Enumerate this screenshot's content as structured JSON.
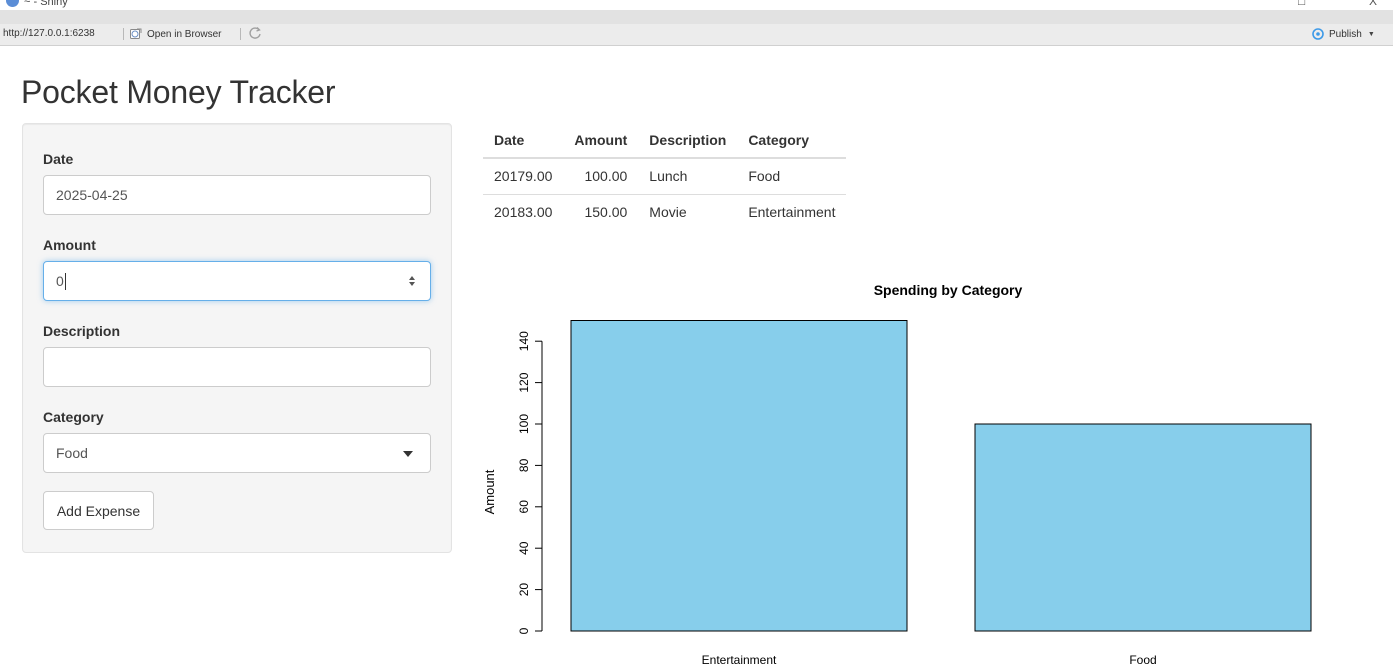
{
  "window": {
    "title": "~ - Shiny",
    "url": "http://127.0.0.1:6238",
    "open_in_browser": "Open in Browser",
    "publish": "Publish",
    "minimize_glyph": "□",
    "close_glyph": "X"
  },
  "page": {
    "title": "Pocket Money Tracker"
  },
  "form": {
    "date_label": "Date",
    "date_value": "2025-04-25",
    "amount_label": "Amount",
    "amount_value": "0",
    "description_label": "Description",
    "description_value": "",
    "category_label": "Category",
    "category_value": "Food",
    "add_button": "Add Expense"
  },
  "table": {
    "headers": [
      "Date",
      "Amount",
      "Description",
      "Category"
    ],
    "rows": [
      [
        "20179.00",
        "100.00",
        "Lunch",
        "Food"
      ],
      [
        "20183.00",
        "150.00",
        "Movie",
        "Entertainment"
      ]
    ]
  },
  "chart_data": {
    "type": "bar",
    "title": "Spending by Category",
    "xlabel": "",
    "ylabel": "Amount",
    "categories": [
      "Entertainment",
      "Food"
    ],
    "values": [
      150,
      100
    ],
    "ylim": [
      0,
      150
    ],
    "yticks": [
      0,
      20,
      40,
      60,
      80,
      100,
      120,
      140
    ],
    "bar_color": "#87ceeb",
    "bar_border_color": "#000000",
    "grid": false
  },
  "colors": {
    "focus_border": "#66afe9",
    "panel_background": "#f5f5f5",
    "publish_icon": "#3d9ae8"
  },
  "icons": {
    "app": "r-shiny-icon",
    "open_in_browser": "globe-icon",
    "refresh": "refresh-icon",
    "publish": "publish-icon",
    "spinner": "number-spinner-icon",
    "select": "dropdown-arrow-icon"
  }
}
